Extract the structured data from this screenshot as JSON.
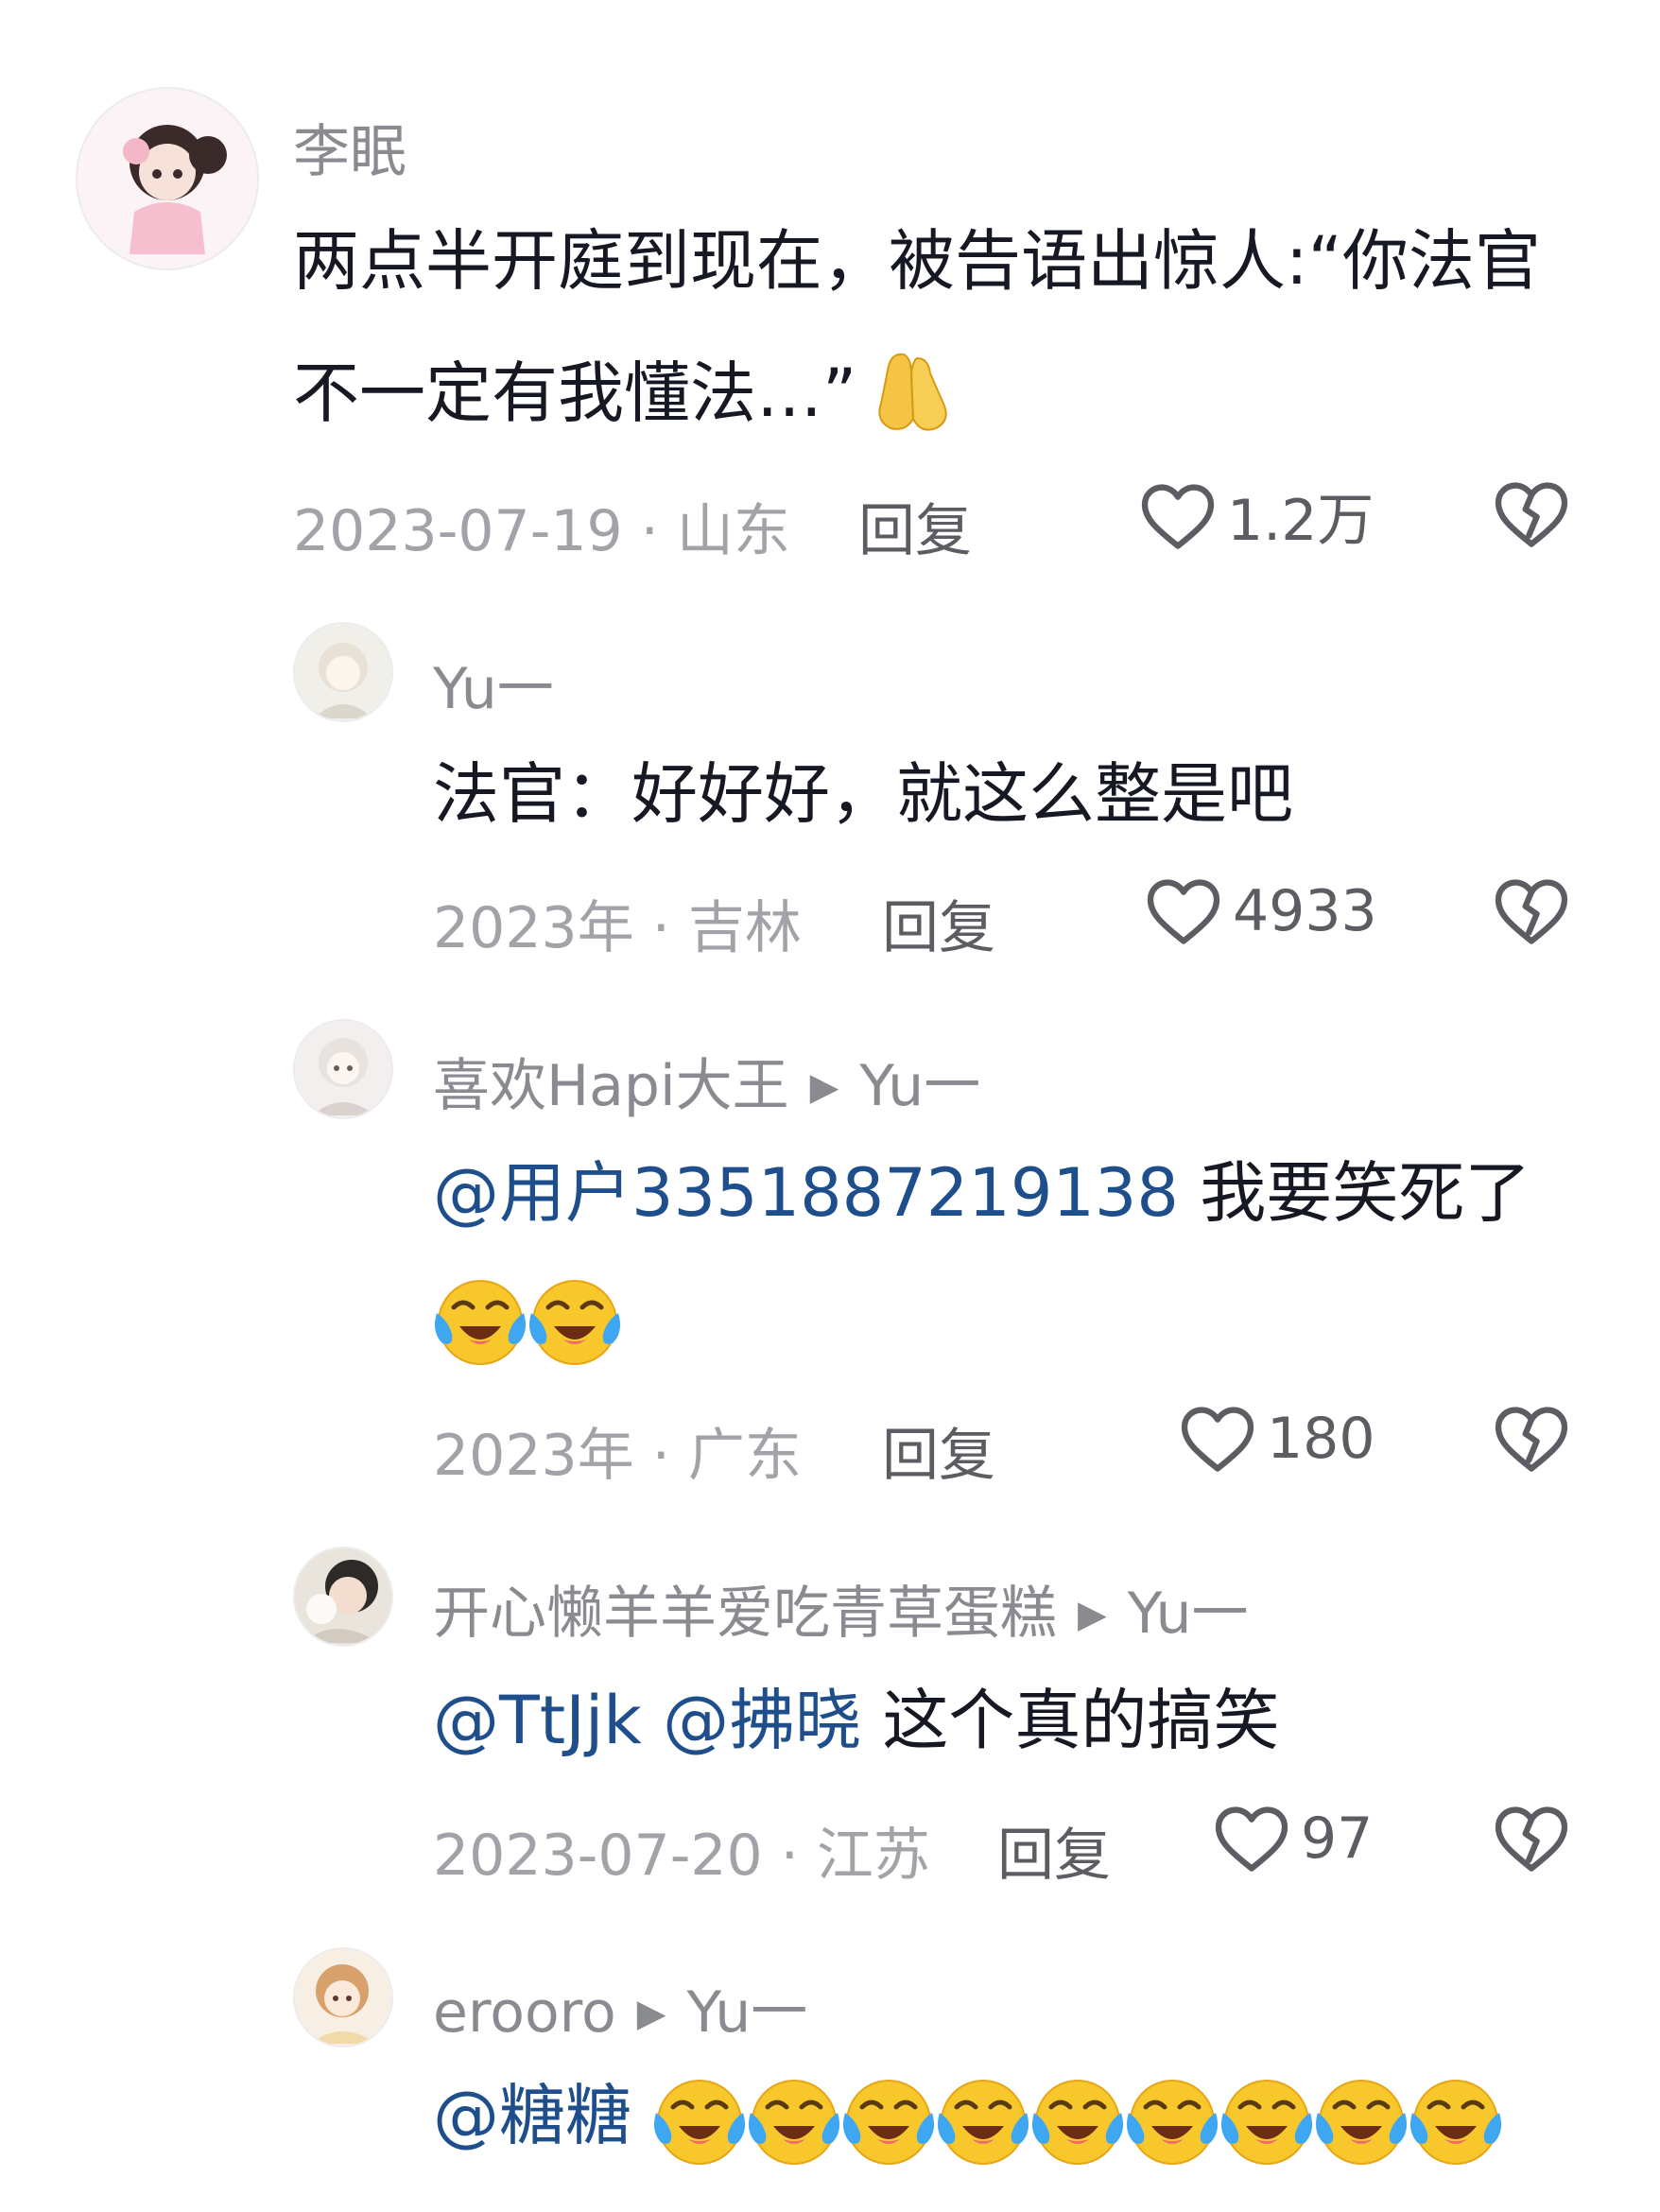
{
  "comments": [
    {
      "username": "李眠",
      "text_line1": "两点半开庭到现在，被告语出惊人:“你法官",
      "text_line2": "不一定有我懂法…”",
      "date_location": "2023-07-19 · 山东",
      "reply_label": "回复",
      "likes": "1.2万"
    },
    {
      "username": "Yu一",
      "text": "法官：好好好，就这么整是吧",
      "date_location": "2023年 · 吉林",
      "reply_label": "回复",
      "likes": "4933"
    },
    {
      "username": "喜欢Hapi大王",
      "reply_to": "Yu一",
      "mention": "@用户3351887219138",
      "text": " 我要笑死了",
      "date_location": "2023年 · 广东",
      "reply_label": "回复",
      "likes": "180"
    },
    {
      "username": "开心懒羊羊爱吃青草蛋糕",
      "reply_to": "Yu一",
      "mention1": "@TtJjk",
      "mention2": "@拂晓",
      "text": " 这个真的搞笑",
      "date_location": "2023-07-20 · 江苏",
      "reply_label": "回复",
      "likes": "97"
    },
    {
      "username": "erooro",
      "reply_to": "Yu一",
      "mention": "@糖糖"
    }
  ],
  "icons": {
    "reply_arrow": "play-triangle-icon",
    "like": "heart-outline-icon",
    "dislike": "broken-heart-icon",
    "pray": "praying-hands-emoji",
    "laugh_cry": "laughing-crying-emoji"
  },
  "colors": {
    "mention": "#1e4f8c",
    "username": "#8a8b91",
    "meta": "#a2a3a8",
    "text": "#161823"
  }
}
